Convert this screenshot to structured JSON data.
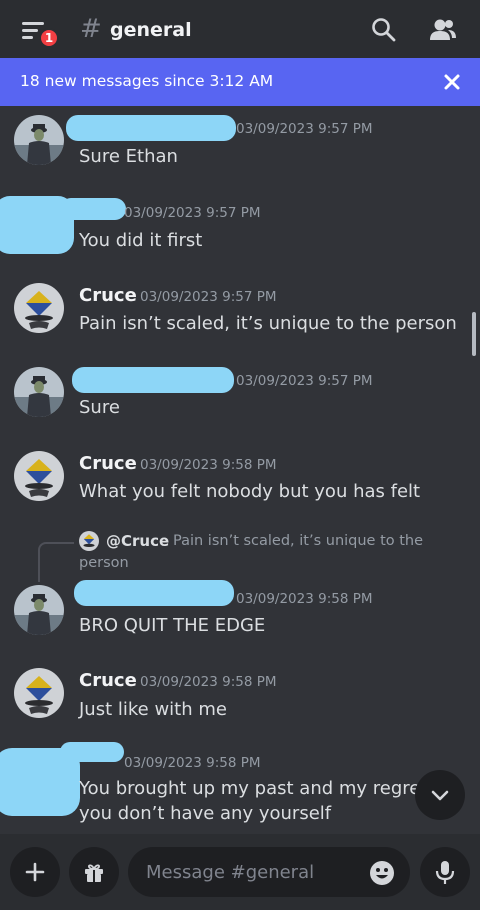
{
  "header": {
    "badge_count": "1",
    "hash": "#",
    "channel_name": "general"
  },
  "banner": {
    "text": "18 new messages since 3:12 AM"
  },
  "messages": [
    {
      "author": "",
      "timestamp": "03/09/2023 9:57 PM",
      "text": "Sure Ethan"
    },
    {
      "author": "",
      "timestamp": "03/09/2023 9:57 PM",
      "text": "You did it first"
    },
    {
      "author": "Cruce",
      "timestamp": "03/09/2023 9:57 PM",
      "text": "Pain isn’t scaled, it’s unique to the person"
    },
    {
      "author": "",
      "timestamp": "03/09/2023 9:57 PM",
      "text": "Sure"
    },
    {
      "author": "Cruce",
      "timestamp": "03/09/2023 9:58 PM",
      "text": "What you felt nobody but you has felt"
    },
    {
      "author": "",
      "timestamp": "03/09/2023 9:58 PM",
      "text": "BRO QUIT THE EDGE"
    },
    {
      "author": "Cruce",
      "timestamp": "03/09/2023 9:58 PM",
      "text": "Just like with me"
    },
    {
      "author": "",
      "timestamp": "03/09/2023 9:58 PM",
      "text_line1": "You brought up my past and my regrets, l",
      "text_line2": "you don’t have any yourself"
    }
  ],
  "reply": {
    "user": "@Cruce",
    "text_line1": "Pain isn’t scaled, it’s unique to the",
    "text_line2": "person"
  },
  "composer": {
    "placeholder": "Message #general"
  },
  "icons": {
    "menu": "menu-icon",
    "search": "search-icon",
    "members": "members-icon",
    "close": "close-icon",
    "chevron": "chevron-down-icon",
    "plus": "plus-icon",
    "gift": "gift-icon",
    "emoji": "emoji-icon",
    "mic": "microphone-icon"
  },
  "colors": {
    "background": "#313338",
    "header": "#2b2d31",
    "banner": "#5865f2",
    "badge": "#f23f43",
    "redaction": "#8dd6f7"
  }
}
